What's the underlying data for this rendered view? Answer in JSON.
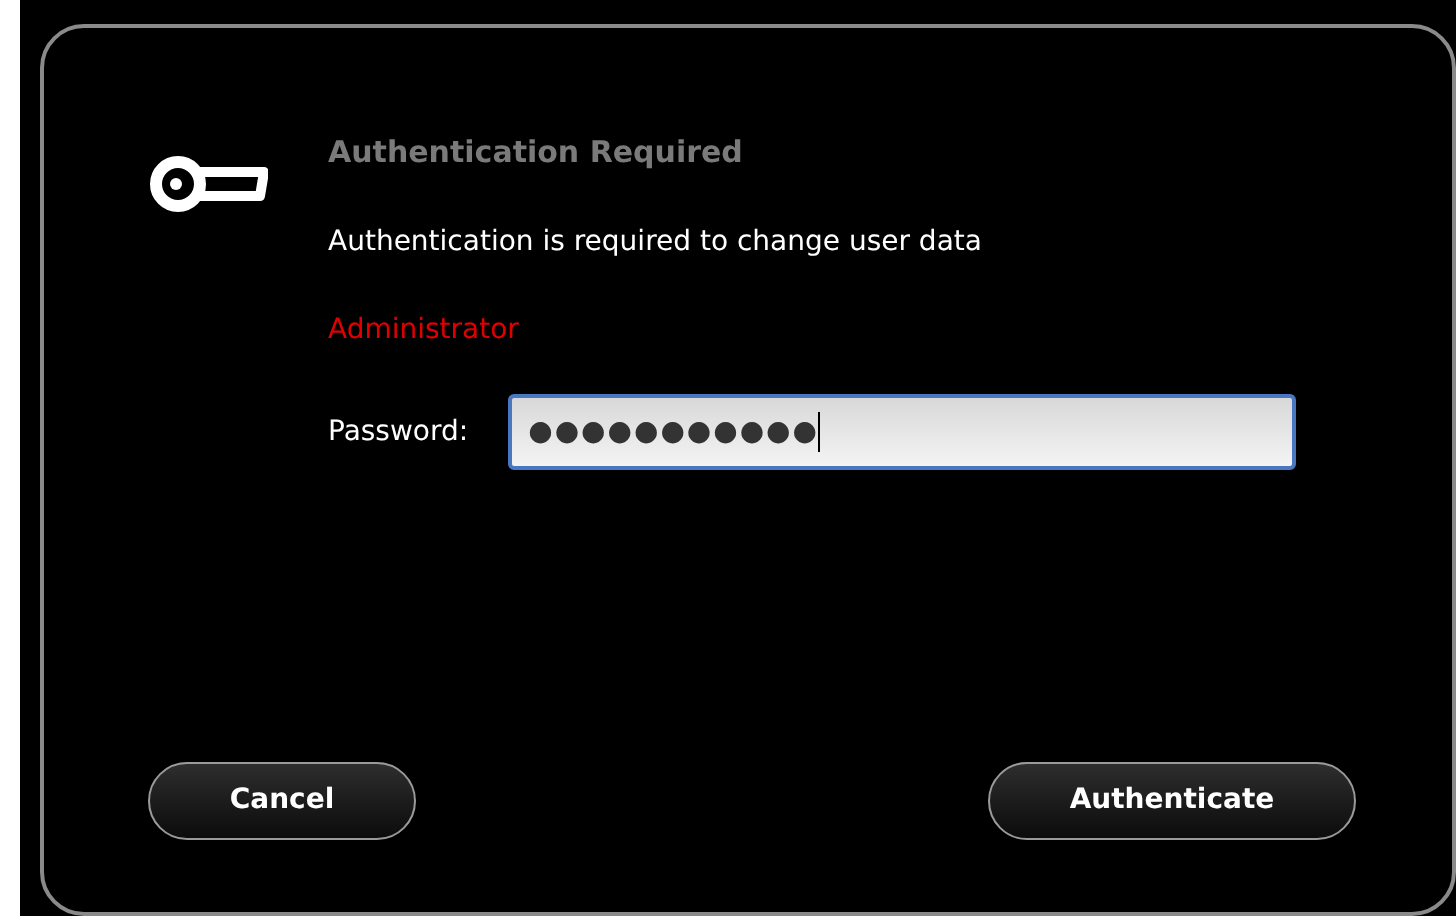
{
  "dialog": {
    "title": "Authentication Required",
    "message": "Authentication is required to change user data",
    "user": "Administrator",
    "password": {
      "label": "Password:",
      "value": "●●●●●●●●●●●",
      "focused": true
    },
    "buttons": [
      {
        "label": "Cancel",
        "kind": "cancel"
      },
      {
        "label": "Authenticate",
        "kind": "default"
      }
    ]
  }
}
